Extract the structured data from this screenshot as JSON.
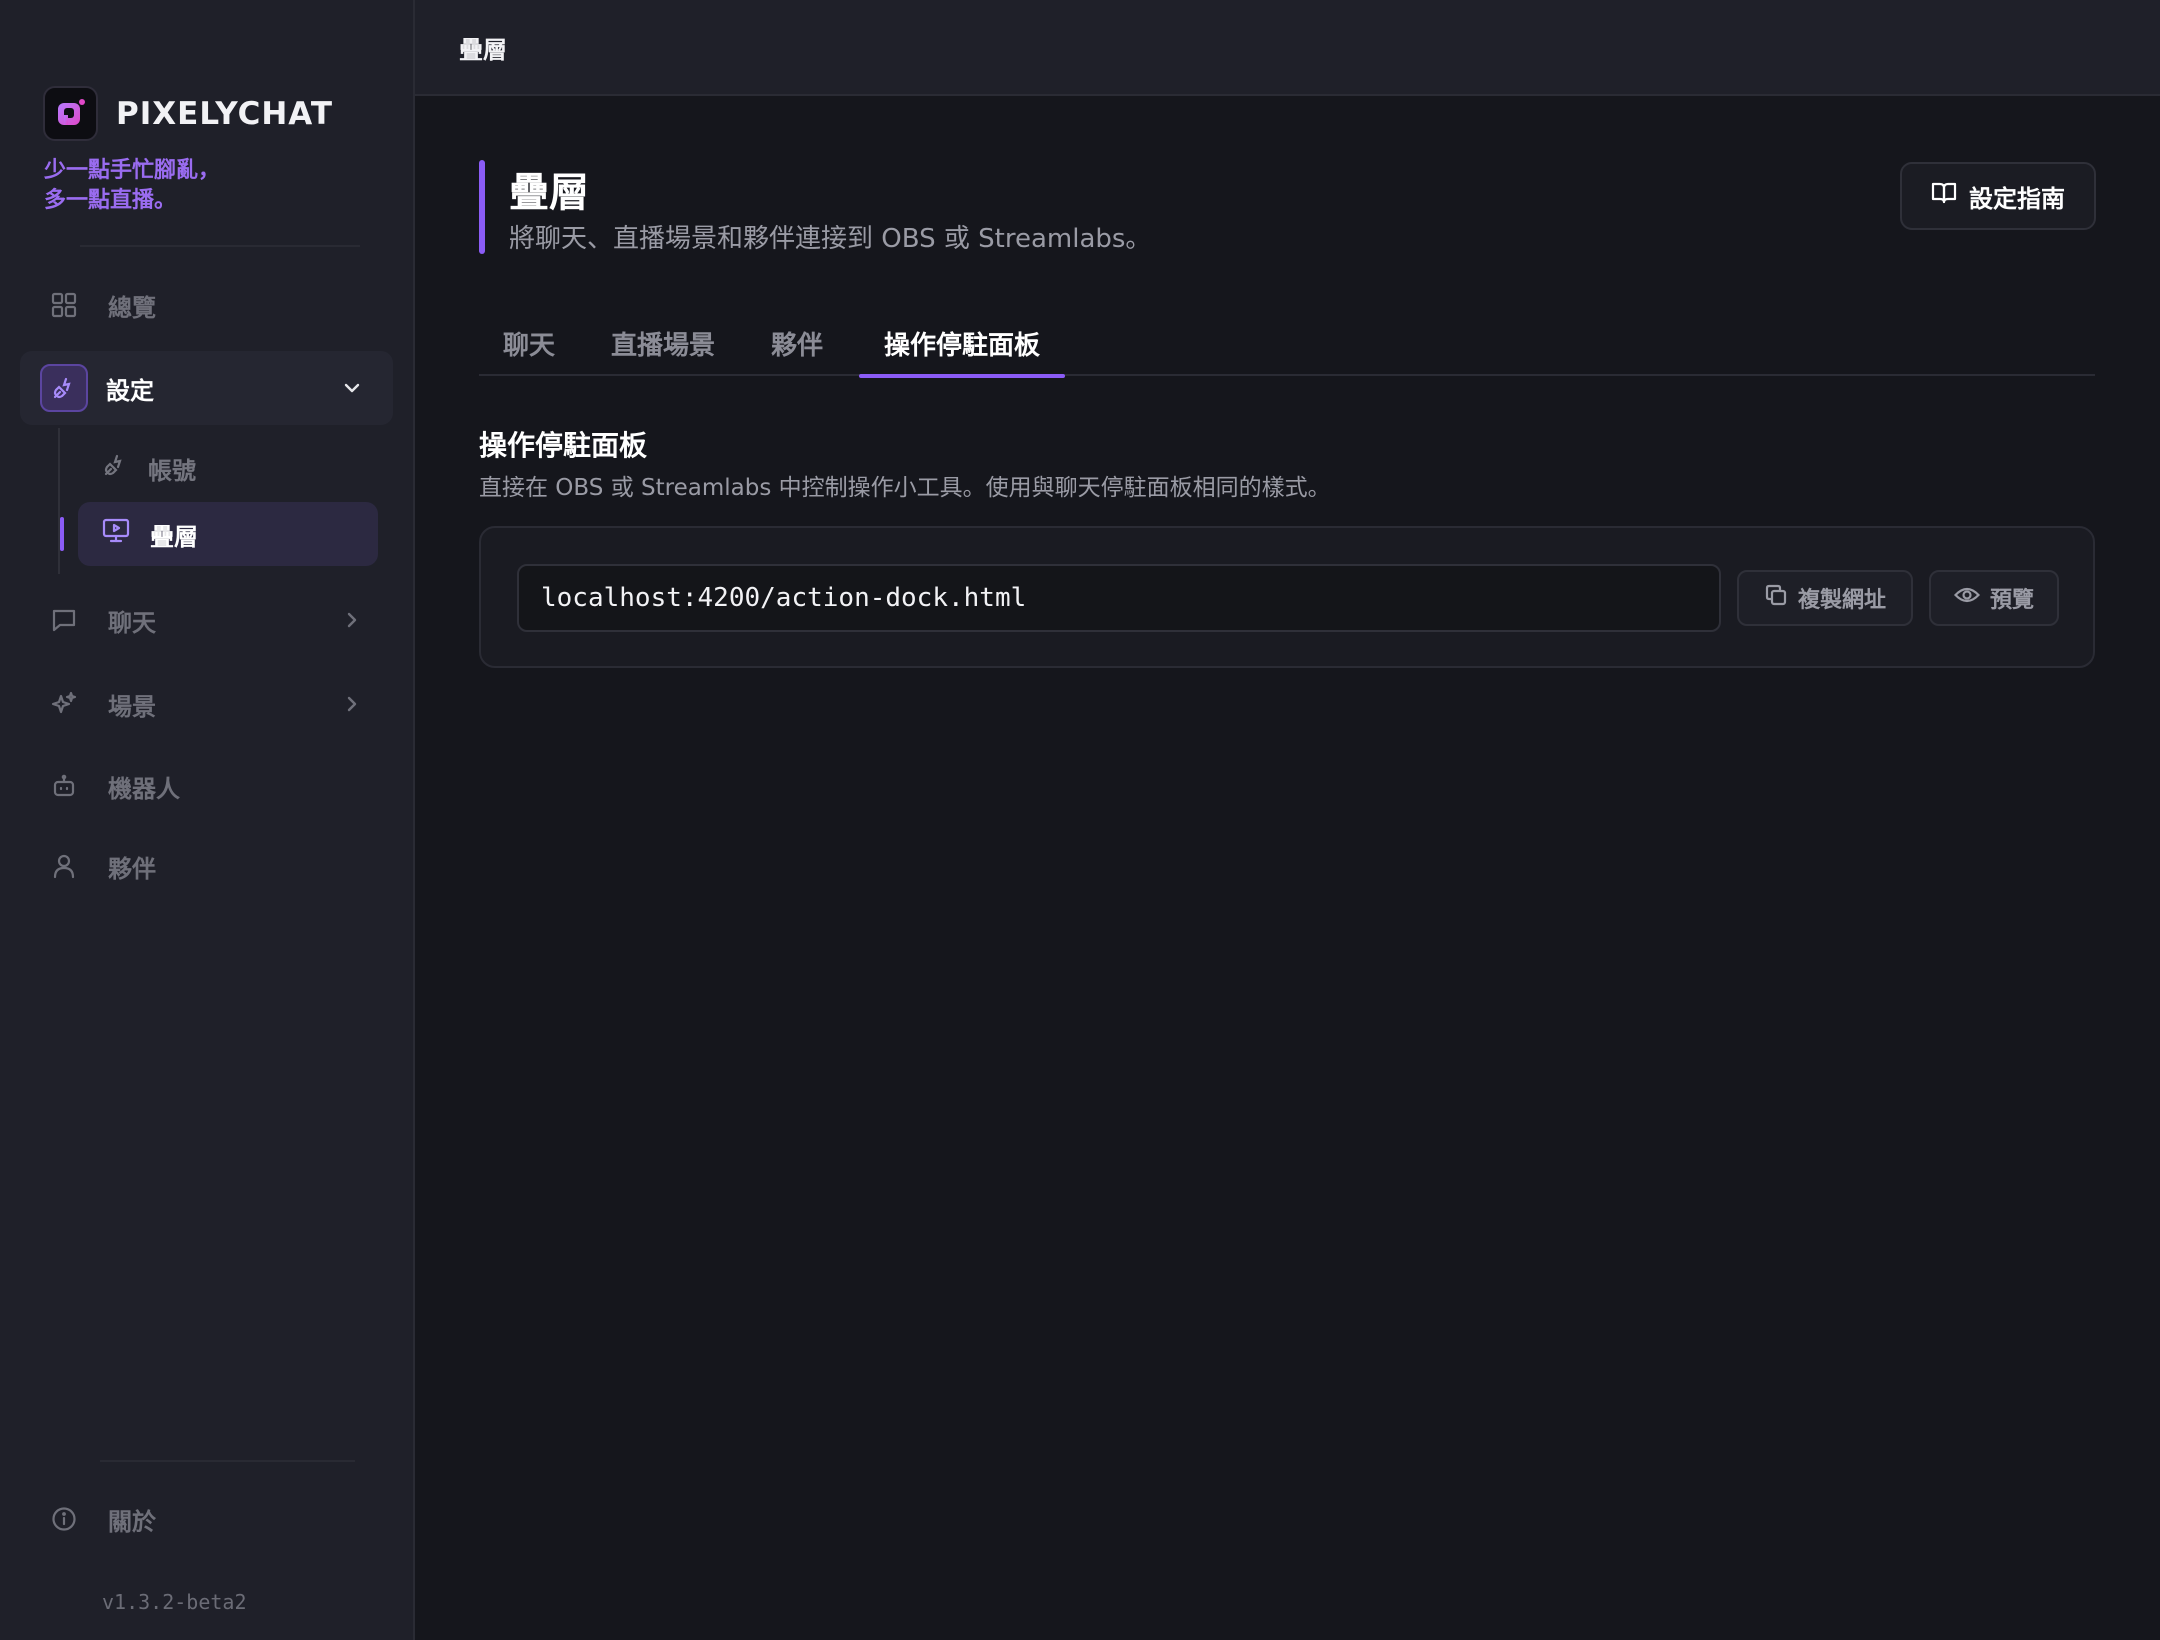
{
  "brand": {
    "name": "PIXELYCHAT",
    "tagline_line1": "少一點手忙腳亂，",
    "tagline_line2": "多一點直播。",
    "accent_color": "#8b5cf6"
  },
  "sidebar": {
    "items": [
      {
        "label": "總覽",
        "icon": "grid-icon"
      },
      {
        "label": "設定",
        "icon": "plug-icon",
        "expanded": true
      },
      {
        "label": "聊天",
        "icon": "chat-bubble-icon"
      },
      {
        "label": "場景",
        "icon": "sparkle-icon"
      },
      {
        "label": "機器人",
        "icon": "robot-icon"
      },
      {
        "label": "夥伴",
        "icon": "user-icon"
      }
    ],
    "sub_items": [
      {
        "label": "帳號",
        "icon": "plug-icon"
      },
      {
        "label": "疊層",
        "icon": "monitor-play-icon",
        "active": true
      }
    ],
    "about_label": "關於",
    "version": "v1.3.2-beta2"
  },
  "topbar": {
    "title": "疊層"
  },
  "page": {
    "title": "疊層",
    "subtitle": "將聊天、直播場景和夥伴連接到 OBS 或 Streamlabs。",
    "guide_button": "設定指南"
  },
  "tabs": [
    {
      "label": "聊天"
    },
    {
      "label": "直播場景"
    },
    {
      "label": "夥伴"
    },
    {
      "label": "操作停駐面板",
      "active": true
    }
  ],
  "section": {
    "title": "操作停駐面板",
    "description": "直接在 OBS 或 Streamlabs 中控制操作小工具。使用與聊天停駐面板相同的樣式。"
  },
  "url_card": {
    "url_value": "localhost:4200/action-dock.html",
    "copy_button": "複製網址",
    "preview_button": "預覽"
  }
}
